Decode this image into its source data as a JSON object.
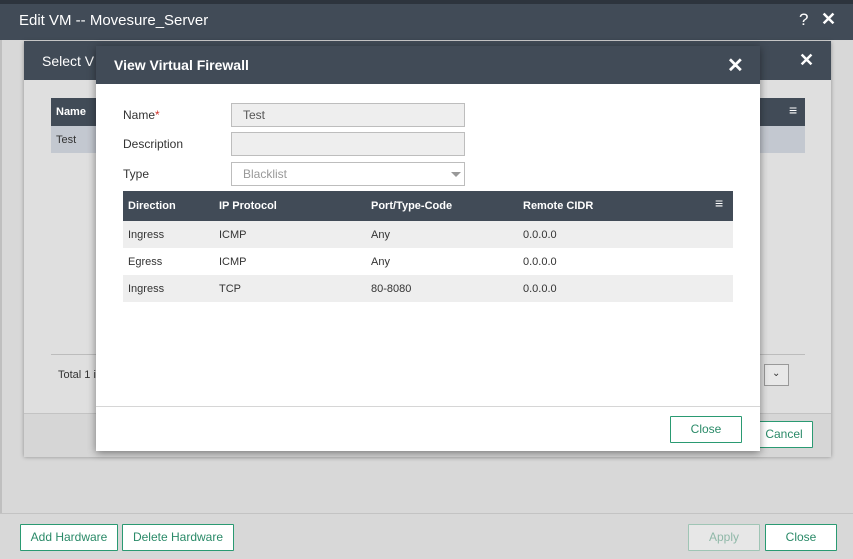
{
  "outer": {
    "title": "Edit VM -- Movesure_Server",
    "help_icon": "?",
    "close_icon": "✕",
    "footer": {
      "add_hardware": "Add Hardware",
      "delete_hardware": "Delete Hardware",
      "apply": "Apply",
      "close": "Close"
    }
  },
  "middle": {
    "title": "Select V",
    "close_icon": "✕",
    "table": {
      "headers": [
        "Name"
      ],
      "menu_icon": "≡",
      "rows": [
        [
          "Test"
        ]
      ]
    },
    "total_text": "Total 1 i",
    "pager_chevron": "⌄",
    "cancel": "Cancel"
  },
  "modal": {
    "title": "View Virtual Firewall",
    "close_icon": "✕",
    "form": {
      "name_label": "Name",
      "name_required": "*",
      "name_value": "Test",
      "description_label": "Description",
      "description_value": "",
      "type_label": "Type",
      "type_value": "Blacklist"
    },
    "rules": {
      "headers": [
        "Direction",
        "IP Protocol",
        "Port/Type-Code",
        "Remote CIDR"
      ],
      "menu_icon": "≡",
      "rows": [
        [
          "Ingress",
          "ICMP",
          "Any",
          "0.0.0.0"
        ],
        [
          "Egress",
          "ICMP",
          "Any",
          "0.0.0.0"
        ],
        [
          "Ingress",
          "TCP",
          "80-8080",
          "0.0.0.0"
        ]
      ]
    },
    "close_button": "Close"
  },
  "colors": {
    "header_bg": "#414b57",
    "accent": "#2a9a72",
    "required": "#d0342c"
  }
}
